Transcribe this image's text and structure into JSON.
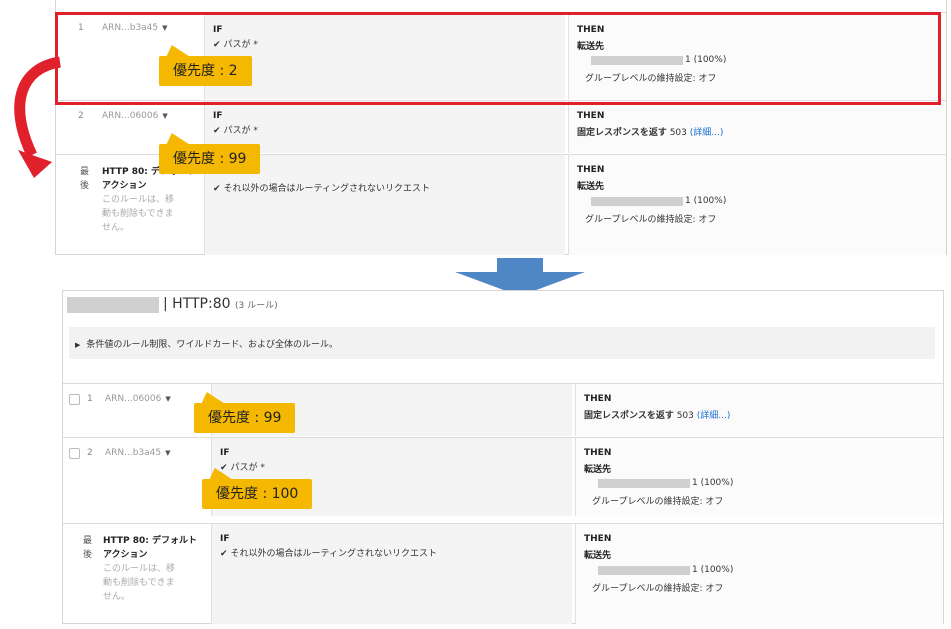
{
  "top_panel": {
    "rows": [
      {
        "index": "1",
        "arn": "ARN...b3a45",
        "if_label": "IF",
        "if_text": "パスが *",
        "then_label": "THEN",
        "action": "転送先",
        "weight": "1 (100%)",
        "stickiness": "グループレベルの維持設定: オフ"
      },
      {
        "index": "2",
        "arn": "ARN...06006",
        "if_label": "IF",
        "if_text": "パスが *",
        "then_label": "THEN",
        "action": "固定レスポンスを返す",
        "code": "503",
        "detail": "(詳細...)"
      }
    ],
    "default_row": {
      "last": "最後",
      "title": "HTTP 80: デフォルトアクション",
      "note": "このルールは、移動も削除もできません。",
      "if_text": "それ以外の場合はルーティングされないリクエスト",
      "then_label": "THEN",
      "action": "転送先",
      "weight": "1 (100%)",
      "stickiness": "グループレベルの維持設定: オフ"
    },
    "badges": [
      "優先度 : 2",
      "優先度 : 99"
    ]
  },
  "bottom_panel": {
    "header": "| HTTP:80",
    "rule_count": "(3 ルール)",
    "info": "条件値のルール制限、ワイルドカード、および全体のルール。",
    "rows": [
      {
        "index": "1",
        "arn": "ARN...06006",
        "then_label": "THEN",
        "action": "固定レスポンスを返す",
        "code": "503",
        "detail": "(詳細...)"
      },
      {
        "index": "2",
        "arn": "ARN...b3a45",
        "if_label": "IF",
        "if_text": "パスが *",
        "then_label": "THEN",
        "action": "転送先",
        "weight": "1 (100%)",
        "stickiness": "グループレベルの維持設定: オフ"
      }
    ],
    "default_row": {
      "last": "最後",
      "title": "HTTP 80: デフォルトアクション",
      "note": "このルールは、移動も削除もできません。",
      "if_label": "IF",
      "if_text": "それ以外の場合はルーティングされないリクエスト",
      "then_label": "THEN",
      "action": "転送先",
      "weight": "1 (100%)",
      "stickiness": "グループレベルの維持設定: オフ"
    },
    "badges": [
      "優先度 : 99",
      "優先度 : 100"
    ]
  },
  "colors": {
    "highlight": "#e0202a",
    "badge": "#f5b800",
    "arrow": "#4f86c6",
    "link": "#1a6fd6"
  },
  "icons": [
    "check-icon",
    "caret-down-icon",
    "curved-red-arrow",
    "down-arrow"
  ]
}
